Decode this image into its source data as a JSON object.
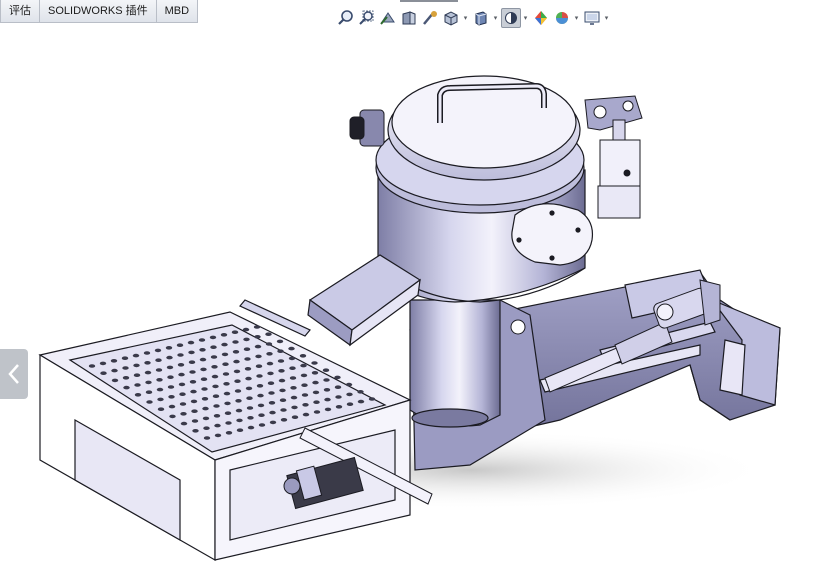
{
  "command_tabs": [
    "评估",
    "SOLIDWORKS 插件",
    "MBD"
  ],
  "view_toolbar": {
    "buttons": [
      {
        "icon": "zoom-to-fit-icon"
      },
      {
        "icon": "zoom-to-area-icon"
      },
      {
        "icon": "previous-view-icon"
      },
      {
        "icon": "section-view-icon"
      },
      {
        "icon": "dynamic-annotation-icon"
      },
      {
        "icon": "view-orientation-icon",
        "dropdown": true
      },
      {
        "icon": "display-style-icon",
        "dropdown": true
      },
      {
        "icon": "hide-show-items-icon",
        "dropdown": true,
        "active": true
      },
      {
        "icon": "edit-appearance-icon"
      },
      {
        "icon": "apply-scene-icon",
        "dropdown": true
      },
      {
        "icon": "view-settings-icon",
        "dropdown": true
      }
    ]
  },
  "graphics_area": {
    "model": "3d-machine-assembly",
    "side_panel_toggle": "chevron-left-icon"
  },
  "colors": {
    "model_body": "#c9c9e6",
    "model_shade": "#7b7ba0",
    "model_light": "#f2f0fb",
    "outline": "#1b1b22",
    "background": "#ffffff"
  }
}
